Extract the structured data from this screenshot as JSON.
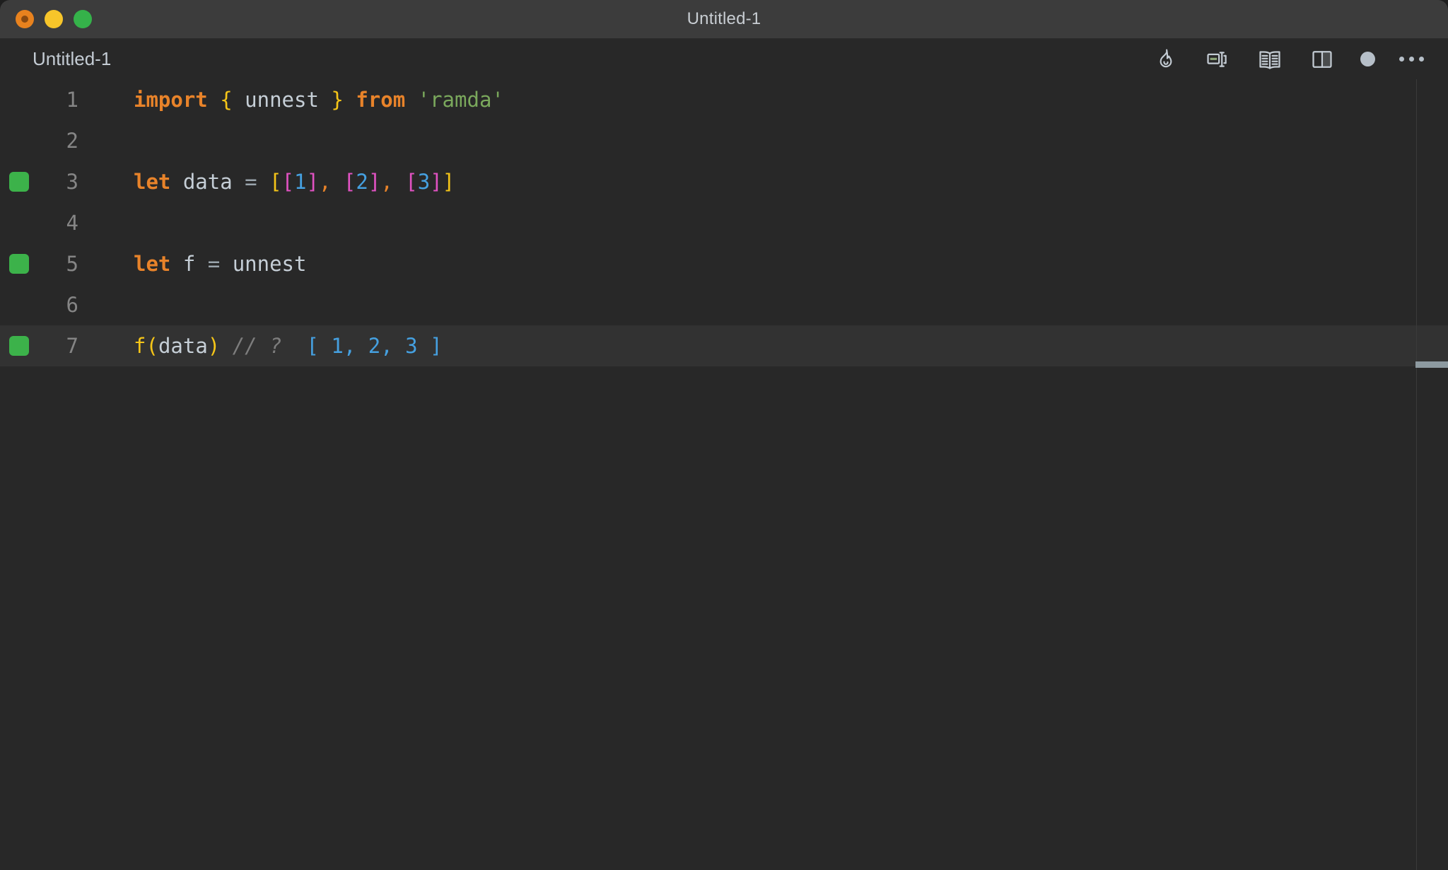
{
  "window": {
    "title": "Untitled-1",
    "traffic_lights": [
      {
        "name": "close",
        "color": "#e8821e"
      },
      {
        "name": "minimize",
        "color": "#f7c52a"
      },
      {
        "name": "maximize",
        "color": "#35b24a"
      }
    ]
  },
  "tab": {
    "label": "Untitled-1"
  },
  "toolbar": {
    "items": [
      {
        "icon": "flame-icon",
        "label": "Start Quokka"
      },
      {
        "icon": "split-editor-icon",
        "label": "Toggle Inline Values"
      },
      {
        "icon": "open-preview-icon",
        "label": "Open Preview"
      },
      {
        "icon": "split-layout-icon",
        "label": "Split Editor"
      },
      {
        "icon": "unsaved-dot-icon",
        "label": "Unsaved Changes"
      },
      {
        "icon": "ellipsis-icon",
        "label": "More Actions"
      }
    ]
  },
  "editor": {
    "language": "javascript",
    "active_line": 7,
    "lines": [
      {
        "number": "1",
        "marker": false,
        "active": false,
        "tokens": [
          {
            "cls": "t-kw",
            "text": "import"
          },
          {
            "cls": "t-plain",
            "text": " "
          },
          {
            "cls": "t-brace",
            "text": "{"
          },
          {
            "cls": "t-plain",
            "text": " unnest "
          },
          {
            "cls": "t-brace",
            "text": "}"
          },
          {
            "cls": "t-plain",
            "text": " "
          },
          {
            "cls": "t-kw",
            "text": "from"
          },
          {
            "cls": "t-plain",
            "text": " "
          },
          {
            "cls": "t-str",
            "text": "'ramda'"
          }
        ]
      },
      {
        "number": "2",
        "marker": false,
        "active": false,
        "tokens": []
      },
      {
        "number": "3",
        "marker": true,
        "active": false,
        "tokens": [
          {
            "cls": "t-kw",
            "text": "let"
          },
          {
            "cls": "t-plain",
            "text": " data "
          },
          {
            "cls": "t-op",
            "text": "="
          },
          {
            "cls": "t-plain",
            "text": " "
          },
          {
            "cls": "t-brkt-y",
            "text": "["
          },
          {
            "cls": "t-brkt-p",
            "text": "["
          },
          {
            "cls": "t-num",
            "text": "1"
          },
          {
            "cls": "t-brkt-p",
            "text": "]"
          },
          {
            "cls": "t-comma",
            "text": ","
          },
          {
            "cls": "t-plain",
            "text": " "
          },
          {
            "cls": "t-brkt-p",
            "text": "["
          },
          {
            "cls": "t-num",
            "text": "2"
          },
          {
            "cls": "t-brkt-p",
            "text": "]"
          },
          {
            "cls": "t-comma",
            "text": ","
          },
          {
            "cls": "t-plain",
            "text": " "
          },
          {
            "cls": "t-brkt-p",
            "text": "["
          },
          {
            "cls": "t-num",
            "text": "3"
          },
          {
            "cls": "t-brkt-p",
            "text": "]"
          },
          {
            "cls": "t-brkt-y",
            "text": "]"
          }
        ]
      },
      {
        "number": "4",
        "marker": false,
        "active": false,
        "tokens": []
      },
      {
        "number": "5",
        "marker": true,
        "active": false,
        "tokens": [
          {
            "cls": "t-kw",
            "text": "let"
          },
          {
            "cls": "t-plain",
            "text": " f "
          },
          {
            "cls": "t-op",
            "text": "="
          },
          {
            "cls": "t-plain",
            "text": " unnest"
          }
        ]
      },
      {
        "number": "6",
        "marker": false,
        "active": false,
        "tokens": []
      },
      {
        "number": "7",
        "marker": true,
        "active": true,
        "tokens": [
          {
            "cls": "t-fn",
            "text": "f"
          },
          {
            "cls": "t-fn",
            "text": "("
          },
          {
            "cls": "t-plain",
            "text": "data"
          },
          {
            "cls": "t-fn",
            "text": ")"
          },
          {
            "cls": "t-plain",
            "text": " "
          },
          {
            "cls": "t-comment",
            "text": "// ?"
          },
          {
            "cls": "t-plain",
            "text": "  "
          },
          {
            "cls": "t-val",
            "text": "[ 1, 2, 3 ]"
          }
        ]
      }
    ]
  }
}
